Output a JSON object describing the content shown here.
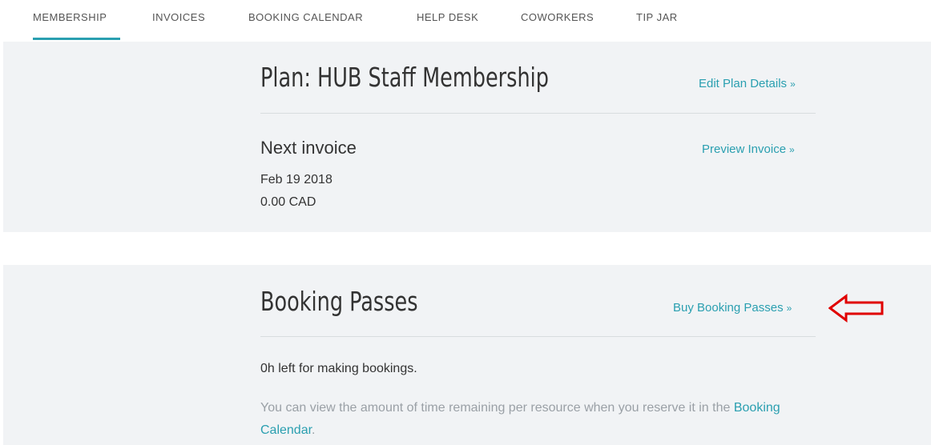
{
  "nav": {
    "items": [
      {
        "label": "MEMBERSHIP",
        "active": true
      },
      {
        "label": "INVOICES",
        "active": false
      },
      {
        "label": "BOOKING CALENDAR",
        "active": false
      },
      {
        "label": "HELP DESK",
        "active": false
      },
      {
        "label": "COWORKERS",
        "active": false
      },
      {
        "label": "TIP JAR",
        "active": false
      }
    ]
  },
  "plan": {
    "title": "Plan: HUB Staff Membership",
    "edit_link": "Edit Plan Details",
    "next_invoice_title": "Next invoice",
    "preview_link": "Preview Invoice",
    "date": "Feb 19 2018",
    "amount": "0.00 CAD"
  },
  "passes": {
    "title": "Booking Passes",
    "buy_link": "Buy Booking Passes",
    "remaining_text": "0h left for making bookings.",
    "info_text_before": "You can view the amount of time remaining per resource when you reserve it in the ",
    "info_link": "Booking Calendar",
    "info_text_after": "."
  },
  "link_suffix": "»",
  "annotation": {
    "icon": "left-arrow-outline-icon",
    "color": "#e00000"
  },
  "colors": {
    "accent": "#2a9fb0",
    "panel_bg": "#f1f3f5",
    "muted_text": "#9aa0a6"
  }
}
